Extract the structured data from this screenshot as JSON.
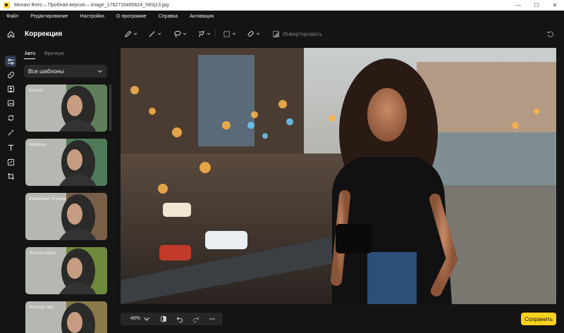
{
  "window": {
    "title": "Movavi Фото – Пробная версия – image_1782716485624_h8Sj13.jpg",
    "controls": [
      "—",
      "☐",
      "✕"
    ]
  },
  "menu": [
    "Файл",
    "Редактирование",
    "Настройки",
    "О программе",
    "Справка",
    "Активация"
  ],
  "rail": {
    "icons": [
      "home-icon",
      "adjustments-icon",
      "bandage-icon",
      "portrait-icon",
      "photo-enhance-icon",
      "replace-icon",
      "magic-wand-icon",
      "text-icon",
      "crop-frame-icon",
      "crop-icon"
    ],
    "active": "adjustments-icon"
  },
  "panel": {
    "title": "Коррекция",
    "tabs": {
      "auto": "Авто",
      "manual": "Вручную"
    },
    "select_value": "Все шаблоны",
    "presets": [
      {
        "label": "Болото",
        "tint": "#5f7f5a"
      },
      {
        "label": "Матрица",
        "tint": "#4f7a58"
      },
      {
        "label": "Кофейный оттенок",
        "tint": "#7a5f48"
      },
      {
        "label": "Лесное озеро",
        "tint": "#6f8a3c"
      },
      {
        "label": "Желтый свет",
        "tint": "#8a7a4a"
      }
    ]
  },
  "toolbar": {
    "tools": [
      "pen-brush-icon",
      "magic-brush-icon",
      "lasso-icon",
      "polygon-lasso-icon",
      "rect-select-icon",
      "eraser-icon",
      "invert-icon",
      "reset-icon"
    ],
    "invert_label": "Инвертировать"
  },
  "bottom": {
    "zoom": "48%",
    "save_label": "Сохранить"
  },
  "colors": {
    "accent": "#f7d21d",
    "background": "#141414",
    "active_rail": "#2f3b52"
  }
}
